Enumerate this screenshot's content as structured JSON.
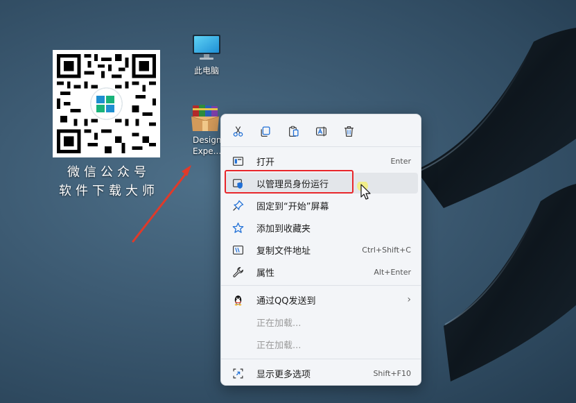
{
  "desktop": {
    "icons": [
      {
        "label": "此电脑",
        "icon": "computer-monitor-icon"
      },
      {
        "label_line1": "Design",
        "label_line2": "Expe...",
        "icon": "winrar-archive-icon"
      }
    ],
    "qr_caption": {
      "line1": "微信公众号",
      "line2": "软件下载大师"
    }
  },
  "context_menu": {
    "toolbar": [
      {
        "name": "cut",
        "icon": "scissors-icon"
      },
      {
        "name": "copy",
        "icon": "copy-icon"
      },
      {
        "name": "paste",
        "icon": "paste-icon"
      },
      {
        "name": "rename",
        "icon": "rename-icon"
      },
      {
        "name": "delete",
        "icon": "trash-icon"
      }
    ],
    "items": [
      {
        "label": "打开",
        "shortcut": "Enter",
        "icon": "open-icon"
      },
      {
        "label": "以管理员身份运行",
        "shortcut": "",
        "icon": "shield-icon"
      },
      {
        "label": "固定到“开始”屏幕",
        "shortcut": "",
        "icon": "pin-icon"
      },
      {
        "label": "添加到收藏夹",
        "shortcut": "",
        "icon": "star-icon"
      },
      {
        "label": "复制文件地址",
        "shortcut": "Ctrl+Shift+C",
        "icon": "copy-path-icon"
      },
      {
        "label": "属性",
        "shortcut": "Alt+Enter",
        "icon": "wrench-icon"
      },
      {
        "label": "通过QQ发送到",
        "shortcut": "",
        "icon": "qq-penguin-icon"
      },
      {
        "label": "正在加载...",
        "shortcut": "",
        "icon": ""
      },
      {
        "label": "正在加载...",
        "shortcut": "",
        "icon": ""
      },
      {
        "label": "显示更多选项",
        "shortcut": "Shift+F10",
        "icon": "more-options-icon"
      }
    ]
  },
  "colors": {
    "highlight_border": "#e8262a",
    "annotation_arrow": "#e03a2a",
    "menu_background": "#f3f5f8",
    "accent_blue": "#1f6fd6"
  }
}
